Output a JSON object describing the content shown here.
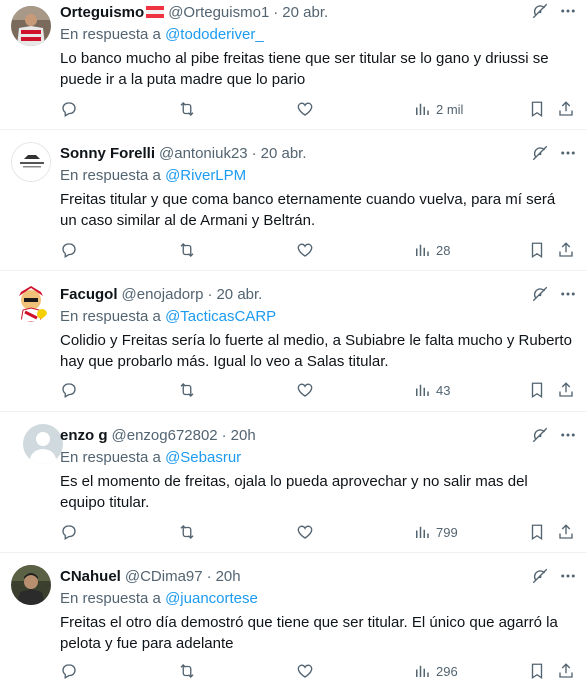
{
  "tweets": [
    {
      "name": "Orteguismo",
      "handle": "@Orteguismo1",
      "time": "20 abr.",
      "reply_prefix": "En respuesta a",
      "reply_to": "@tododeriver_",
      "text": "Lo banco mucho al pibe freitas tiene que ser titular se lo gano y driussi se puede ir a la puta madre que lo pario",
      "views": "2 mil",
      "avatar": "avatar-red-white-jersey"
    },
    {
      "name": "Sonny Forelli",
      "handle": "@antoniuk23",
      "time": "20 abr.",
      "reply_prefix": "En respuesta a",
      "reply_to": "@RiverLPM",
      "text": "Freitas titular y que coma banco eternamente cuando vuelva, para mí será un caso similar al de Armani y Beltrán.",
      "views": "28",
      "avatar": "avatar-logo"
    },
    {
      "name": "Facugol",
      "handle": "@enojadorp",
      "time": "20 abr.",
      "reply_prefix": "En respuesta a",
      "reply_to": "@TacticasCARP",
      "text": "Colidio y Freitas sería lo fuerte al medio, a Subiabre le falta mucho y Ruberto hay que probarlo más. Igual lo veo a Salas titular.",
      "views": "43",
      "avatar": "avatar-cartoon"
    },
    {
      "name": "enzo g",
      "handle": "@enzog672802",
      "time": "20h",
      "reply_prefix": "En respuesta a",
      "reply_to": "@Sebasrur",
      "text": "Es el momento de freitas, ojala lo pueda aprovechar y no salir mas del equipo titular.",
      "views": "799",
      "avatar": "avatar-default"
    },
    {
      "name": "CNahuel",
      "handle": "@CDima97",
      "time": "20h",
      "reply_prefix": "En respuesta a",
      "reply_to": "@juancortese",
      "text": "Freitas el otro día demostró que tiene que ser titular. El único que agarró la pelota y fue para adelante",
      "views": "296",
      "avatar": "avatar-photo"
    }
  ],
  "colors": {
    "link": "#1d9bf0",
    "secondary": "#536471",
    "text": "#0f1419",
    "divider": "#eff3f4"
  }
}
